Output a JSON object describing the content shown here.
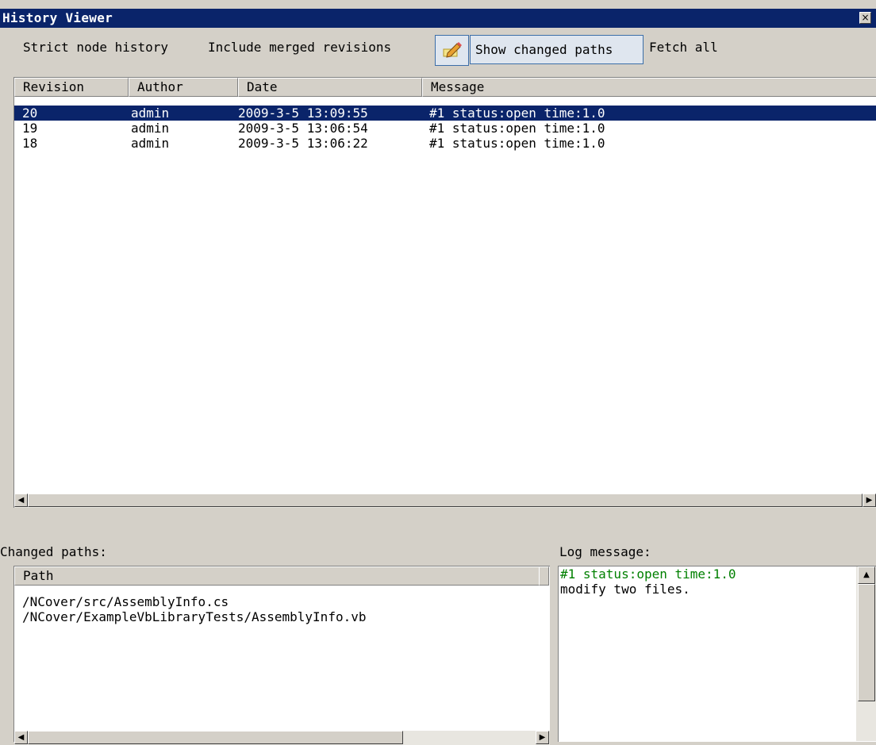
{
  "window": {
    "title": "History Viewer",
    "close_glyph": "×"
  },
  "toolbar": {
    "strict_node_history": "Strict node history",
    "include_merged": "Include merged revisions",
    "edit_icon": "pencil-note-icon",
    "show_changed_paths": "Show changed paths",
    "fetch_all": "Fetch all"
  },
  "revisions": {
    "columns": [
      "Revision",
      "Author",
      "Date",
      "Message"
    ],
    "rows": [
      {
        "revision": "20",
        "author": "admin",
        "date": "2009-3-5 13:09:55",
        "message": "#1 status:open time:1.0",
        "selected": true
      },
      {
        "revision": "19",
        "author": "admin",
        "date": "2009-3-5 13:06:54",
        "message": "#1 status:open time:1.0",
        "selected": false
      },
      {
        "revision": "18",
        "author": "admin",
        "date": "2009-3-5 13:06:22",
        "message": "#1 status:open time:1.0",
        "selected": false
      }
    ]
  },
  "changed_paths": {
    "label": "Changed paths:",
    "column": "Path",
    "items": [
      "/NCover/src/AssemblyInfo.cs",
      "/NCover/ExampleVbLibraryTests/AssemblyInfo.vb"
    ]
  },
  "log_message": {
    "label": "Log message:",
    "lines": [
      "#1 status:open time:1.0",
      "modify two files."
    ]
  },
  "scroll": {
    "left_arrow": "◀",
    "right_arrow": "▶",
    "up_arrow": "▲"
  },
  "colors": {
    "title_bar": "#0a246a",
    "selection": "#0a246a",
    "log_first_line": "#008000",
    "window_bg": "#d4d0c8"
  }
}
